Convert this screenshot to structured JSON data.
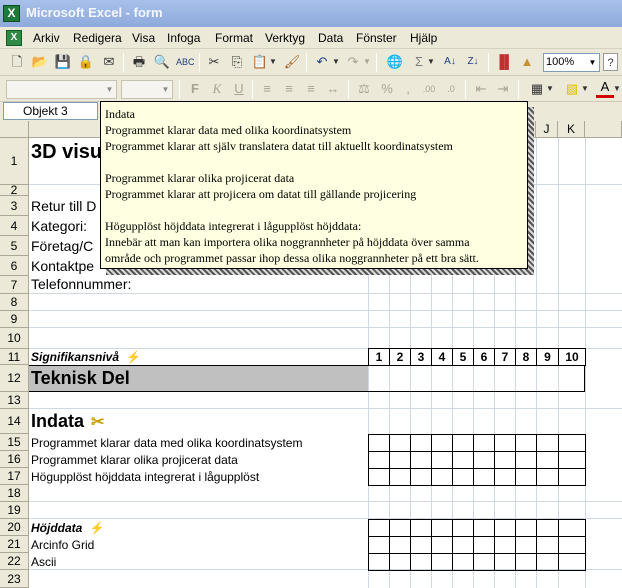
{
  "app": {
    "title": "Microsoft Excel - form",
    "icon": "excel-app-icon"
  },
  "menu": [
    "Arkiv",
    "Redigera",
    "Visa",
    "Infoga",
    "Format",
    "Verktyg",
    "Data",
    "Fönster",
    "Hjälp"
  ],
  "toolbar": {
    "zoom": "100%"
  },
  "formula_bar": {
    "name_box": "Objekt 3"
  },
  "columns": {
    "j": "J",
    "k": "K"
  },
  "rows": [
    "1",
    "2",
    "3",
    "4",
    "5",
    "6",
    "7",
    "8",
    "9",
    "10",
    "11",
    "12",
    "13",
    "14",
    "15",
    "16",
    "17",
    "18",
    "19",
    "20",
    "21",
    "22",
    "23"
  ],
  "sheet": {
    "r1": "3D visu",
    "r3": "Retur till D",
    "r4": "Kategori:",
    "r5": "Företag/C",
    "r6": "Kontaktpe",
    "r7": "Telefonnummer:",
    "r11": "Signifikansnivå",
    "r12": "Teknisk Del",
    "r14": "Indata",
    "r15": "Programmet klarar data med olika koordinatsystem",
    "r16": "Programmet klarar olika projicerat data",
    "r17": "Högupplöst höjddata integrerat i lågupplöst",
    "r20": "Höjddata",
    "r21": "Arcinfo Grid",
    "r22": "Ascii"
  },
  "rating_scale": [
    "1",
    "2",
    "3",
    "4",
    "5",
    "6",
    "7",
    "8",
    "9",
    "10"
  ],
  "comment": {
    "lines": [
      "Indata",
      "Programmet klarar data med olika koordinatsystem",
      "Programmet klarar att själv translatera datat till aktuellt koordinatsystem",
      "",
      "Programmet klarar olika projicerat data",
      "Programmet klarar att projicera om datat till gällande projicering",
      "",
      "Högupplöst höjddata integrerat i lågupplöst höjddata:",
      "Innebär att man kan importera olika noggrannheter på höjddata över samma",
      "område och programmet passar ihop dessa olika noggrannheter på ett bra sätt."
    ]
  }
}
